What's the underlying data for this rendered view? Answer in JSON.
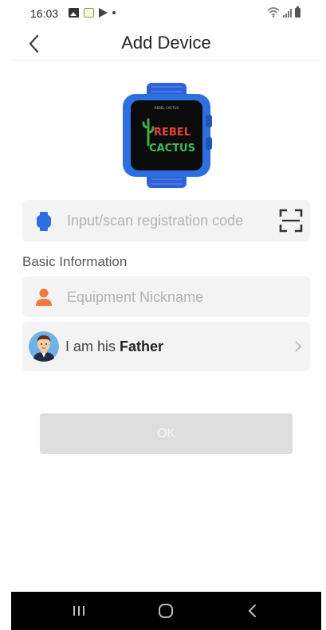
{
  "status_bar": {
    "time": "16:03"
  },
  "header": {
    "title": "Add Device"
  },
  "registration": {
    "placeholder": "Input/scan registration code",
    "value": ""
  },
  "basic_info": {
    "label": "Basic Information",
    "nickname_placeholder": "Equipment Nickname",
    "nickname_value": "",
    "relation_prefix": "I am his",
    "relation_value": "Father"
  },
  "actions": {
    "ok_label": "OK"
  },
  "watch": {
    "brand_line1": "REBEL",
    "brand_line2": "CACTUS",
    "strap_small_text": "REBEL CACTUS"
  },
  "colors": {
    "accent_blue": "#2b6fe0",
    "person_orange": "#f07b3f",
    "button_disabled": "#dedede",
    "field_bg": "#f3f3f3"
  }
}
